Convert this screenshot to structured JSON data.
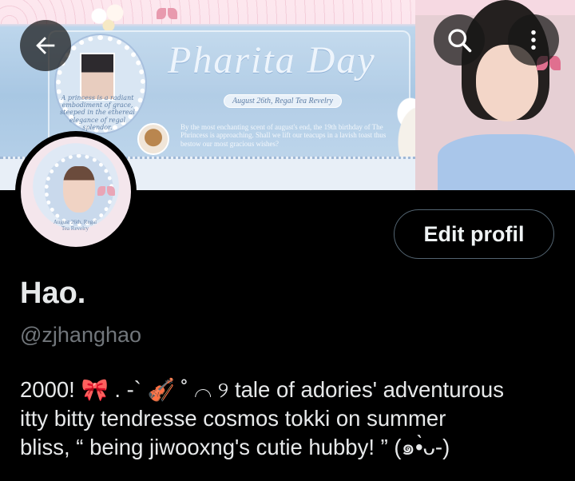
{
  "banner": {
    "title": "Pharita Day",
    "tagline": "A princess is a radiant embodiment of grace, steeped in the ethereal elegance of regal splendor.",
    "date_label": "August 26th, Regal Tea Revelry",
    "message": "By the most enchanting scent of august's end, the 19th birthday of The Phrincess is approaching. Shall we lift our teacups in a lavish toast thus bestow our most gracious wishes?"
  },
  "avatar": {
    "caption": "August 26th, Regal Tea Revelry"
  },
  "toolbar": {
    "back_icon": "arrow-left-icon",
    "search_icon": "search-icon",
    "more_icon": "more-vertical-icon"
  },
  "profile": {
    "edit_label": "Edit profil",
    "display_name": "Hao.",
    "handle": "@zjhanghao",
    "bio_lines": [
      "2000! 🎀 . -` 🎻 ˚ ⌒ ୨ tale of adories' adventurous",
      "itty bitty tendresse cosmos tokki on summer",
      "bliss, “ being jiwooxng's cutie hubby! ” (๑•̀ᴗ-)"
    ]
  },
  "colors": {
    "background": "#000000",
    "text_primary": "#e7e9ea",
    "text_secondary": "#71767b",
    "button_border": "#536471"
  }
}
